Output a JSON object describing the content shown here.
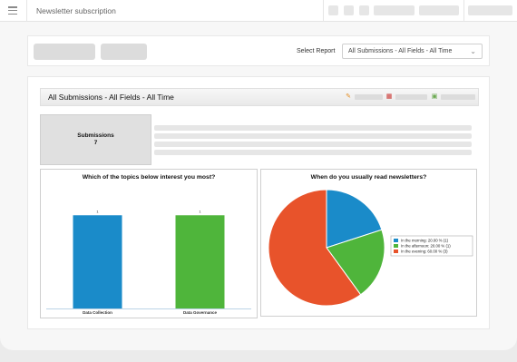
{
  "app": {
    "title": "Newsletter subscription"
  },
  "toolbar": {
    "select_label": "Select Report",
    "select_value": "All Submissions - All Fields - All Time"
  },
  "report": {
    "title": "All Submissions - All Fields - All Time",
    "submissions_label": "Submissions",
    "submissions_count": "7"
  },
  "colors": {
    "blue": "#1a8bc9",
    "green": "#4fb53b",
    "orange": "#e8532b"
  },
  "icons": {
    "edit": "pencil-icon",
    "pdf": "pdf-icon",
    "export": "export-icon",
    "menu": "hamburger-menu-icon"
  },
  "chart_data": [
    {
      "type": "bar",
      "title": "Which of the topics below interest you most?",
      "categories": [
        "Data Collection",
        "Data Governance"
      ],
      "values": [
        1,
        1
      ],
      "data_labels": [
        "1",
        "1"
      ],
      "colors": [
        "#1a8bc9",
        "#4fb53b"
      ],
      "ylim": [
        0,
        1.1
      ],
      "grid": false
    },
    {
      "type": "pie",
      "title": "When do you usually read newsletters?",
      "labels": [
        "In the morning",
        "In the afternoon",
        "In the evening"
      ],
      "values": [
        20.0,
        20.0,
        60.0
      ],
      "counts": [
        1,
        1,
        3
      ],
      "legend_entries": [
        "In the morning: 20.00 % (1)",
        "In the afternoon: 20.00 % (1)",
        "In the evening: 60.00 % (3)"
      ],
      "colors": [
        "#1a8bc9",
        "#4fb53b",
        "#e8532b"
      ],
      "legend_position": "right"
    }
  ]
}
